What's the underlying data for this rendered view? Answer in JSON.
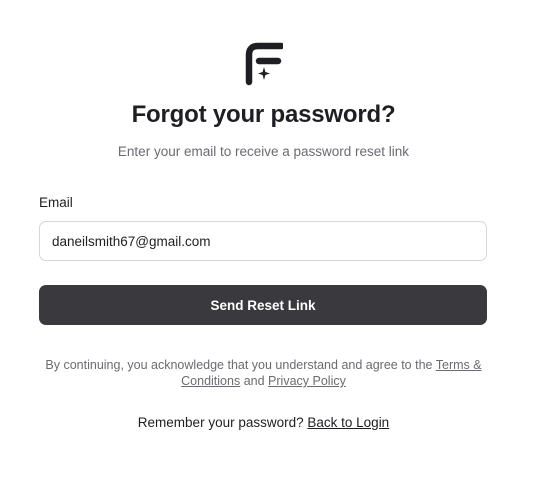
{
  "brand": {
    "logo_icon": "brand-f-sparkle-logo",
    "logo_color": "#1f1f23"
  },
  "header": {
    "title": "Forgot your password?",
    "subtitle": "Enter your email to receive a password reset link"
  },
  "form": {
    "email_label": "Email",
    "email_value": "daneilsmith67@gmail.com",
    "submit_label": "Send Reset Link",
    "submit_color": "#3a3a3e"
  },
  "legal": {
    "prefix": "By continuing, you acknowledge that you understand and agree to the",
    "terms_link": "Terms & Conditions",
    "and_text": "and",
    "privacy_link": "Privacy Policy"
  },
  "footer": {
    "remember_text": "Remember your password?",
    "back_link": "Back to Login"
  }
}
